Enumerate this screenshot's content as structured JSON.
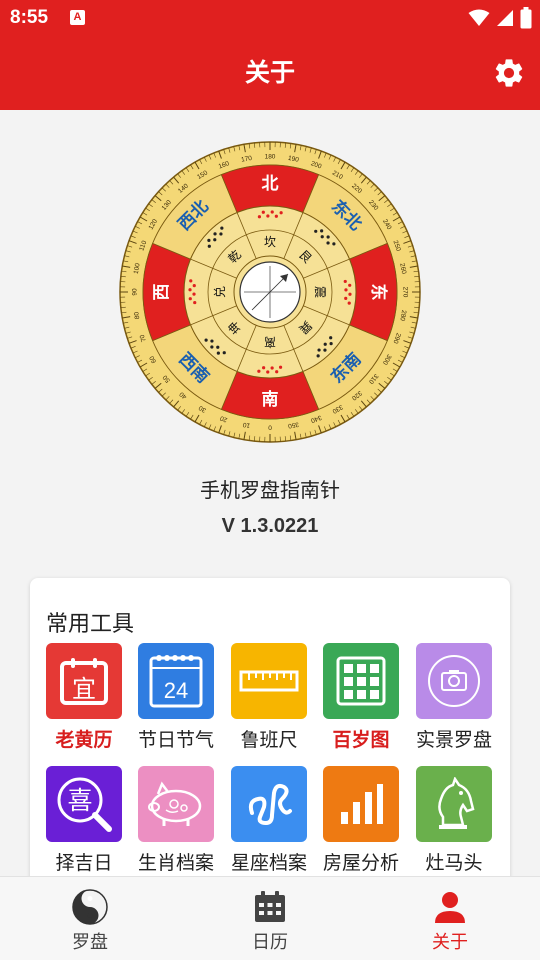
{
  "status_bar": {
    "time": "8:55",
    "app_icon_letter": "A"
  },
  "header": {
    "title": "关于"
  },
  "compass": {
    "directions": [
      "东南",
      "南",
      "西南",
      "西",
      "西北",
      "北",
      "东北",
      "东"
    ],
    "trigrams": [
      "巽",
      "离",
      "坤",
      "兑",
      "乾",
      "坎",
      "艮",
      "震"
    ],
    "degree_ticks": [
      "0",
      "10",
      "20",
      "30",
      "40",
      "50",
      "60",
      "70",
      "80",
      "90",
      "100",
      "110",
      "120",
      "130",
      "140",
      "150",
      "160",
      "170",
      "180",
      "190",
      "200",
      "210",
      "220",
      "230",
      "240",
      "250",
      "260",
      "270",
      "280",
      "290",
      "300",
      "310",
      "320",
      "330",
      "340",
      "350"
    ]
  },
  "about": {
    "app_name": "手机罗盘指南针",
    "version": "V 1.3.0221"
  },
  "tools": {
    "title": "常用工具",
    "calendar_day": "24",
    "items": [
      {
        "label": "老黄历",
        "color": "#e53935",
        "highlight": true,
        "glyph": "宜"
      },
      {
        "label": "节日节气",
        "color": "#2f7de1",
        "highlight": false,
        "glyph": "24"
      },
      {
        "label": "鲁班尺",
        "color": "#f7b500",
        "highlight": false,
        "glyph": "ruler"
      },
      {
        "label": "百岁图",
        "color": "#3aa856",
        "highlight": true,
        "glyph": "grid"
      },
      {
        "label": "实景罗盘",
        "color": "#b98be8",
        "highlight": false,
        "glyph": "camera"
      },
      {
        "label": "择吉日",
        "color": "#6a1fd6",
        "highlight": false,
        "glyph": "喜"
      },
      {
        "label": "生肖档案",
        "color": "#ec8fc2",
        "highlight": false,
        "glyph": "pig"
      },
      {
        "label": "星座档案",
        "color": "#3b8ef0",
        "highlight": false,
        "glyph": "leo"
      },
      {
        "label": "房屋分析",
        "color": "#ee7a12",
        "highlight": false,
        "glyph": "bars"
      },
      {
        "label": "灶马头",
        "color": "#6ab04c",
        "highlight": false,
        "glyph": "horse"
      }
    ]
  },
  "bottom_nav": {
    "items": [
      {
        "label": "罗盘",
        "active": false
      },
      {
        "label": "日历",
        "active": false
      },
      {
        "label": "关于",
        "active": true
      }
    ]
  },
  "colors": {
    "accent": "#e0201f",
    "compass_gold": "#f3d67a",
    "compass_red": "#e0201f",
    "compass_blue": "#1a5fb0"
  }
}
